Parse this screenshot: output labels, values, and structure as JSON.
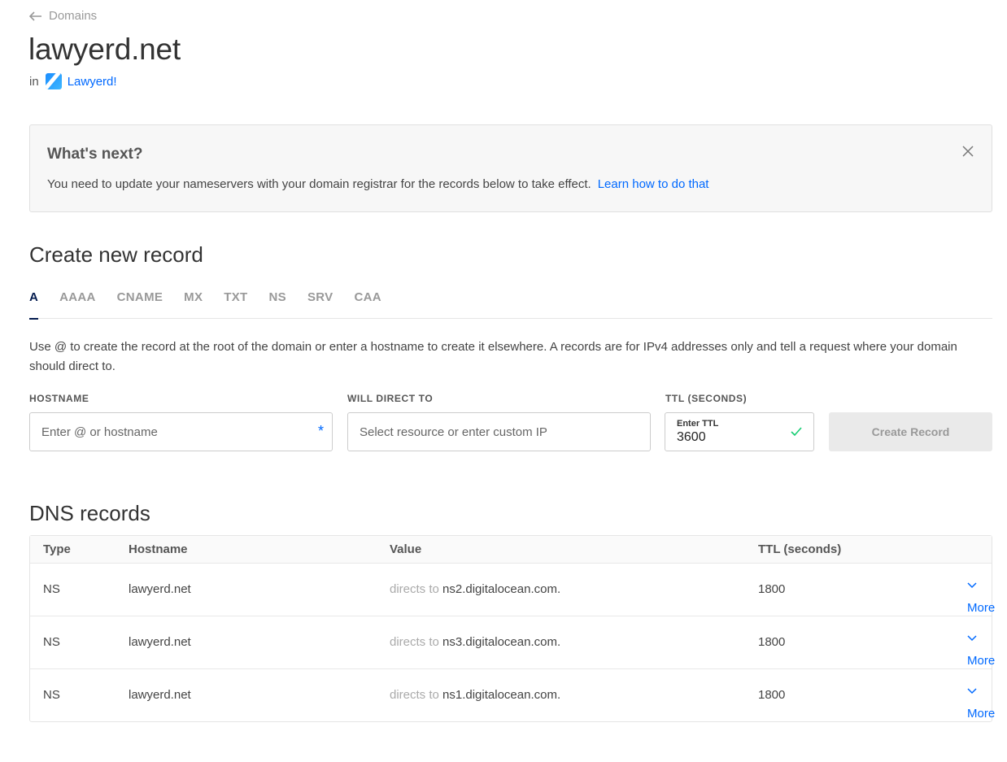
{
  "nav": {
    "back_label": "Domains"
  },
  "domain": {
    "name": "lawyerd.net",
    "in_label": "in",
    "project_name": "Lawyerd!"
  },
  "notice": {
    "title": "What's next?",
    "message": "You need to update your nameservers with your domain registrar for the records below to take effect.",
    "link_label": "Learn how to do that"
  },
  "create": {
    "heading": "Create new record",
    "tabs": [
      "A",
      "AAAA",
      "CNAME",
      "MX",
      "TXT",
      "NS",
      "SRV",
      "CAA"
    ],
    "active_tab": "A",
    "description": "Use @ to create the record at the root of the domain or enter a hostname to create it elsewhere. A records are for IPv4 addresses only and tell a request where your domain should direct to.",
    "hostname_label": "HOSTNAME",
    "hostname_placeholder": "Enter @ or hostname",
    "required_mark": "*",
    "direct_label": "WILL DIRECT TO",
    "direct_placeholder": "Select resource or enter custom IP",
    "ttl_label": "TTL (SECONDS)",
    "ttl_small_label": "Enter TTL",
    "ttl_value": "3600",
    "button_label": "Create Record"
  },
  "records": {
    "heading": "DNS records",
    "columns": {
      "type": "Type",
      "hostname": "Hostname",
      "value": "Value",
      "ttl": "TTL (seconds)"
    },
    "directs_prefix": "directs to",
    "more_label": "More",
    "rows": [
      {
        "type": "NS",
        "hostname": "lawyerd.net",
        "value": "ns2.digitalocean.com.",
        "ttl": "1800"
      },
      {
        "type": "NS",
        "hostname": "lawyerd.net",
        "value": "ns3.digitalocean.com.",
        "ttl": "1800"
      },
      {
        "type": "NS",
        "hostname": "lawyerd.net",
        "value": "ns1.digitalocean.com.",
        "ttl": "1800"
      }
    ]
  }
}
